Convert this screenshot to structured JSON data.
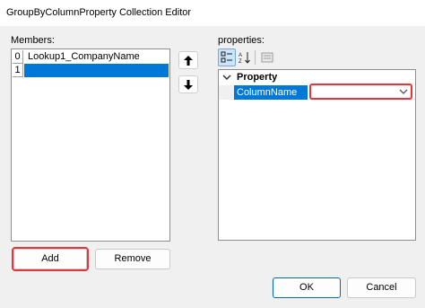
{
  "window": {
    "title": "GroupByColumnProperty Collection Editor"
  },
  "members": {
    "label": "Members:",
    "items": [
      {
        "index": "0",
        "name": "Lookup1_CompanyName"
      },
      {
        "index": "1",
        "name": ""
      }
    ],
    "add_label": "Add",
    "remove_label": "Remove"
  },
  "properties": {
    "label": "properties:",
    "category": "Property",
    "rows": [
      {
        "name": "ColumnName",
        "value": ""
      }
    ]
  },
  "footer": {
    "ok_label": "OK",
    "cancel_label": "Cancel"
  },
  "colors": {
    "selection": "#0078d7",
    "highlight": "#e8333a"
  },
  "icons": [
    "move-up-icon",
    "move-down-icon",
    "categorized-icon",
    "alphabetical-icon",
    "property-pages-icon",
    "chevron-down-icon",
    "dropdown-arrow-icon"
  ]
}
